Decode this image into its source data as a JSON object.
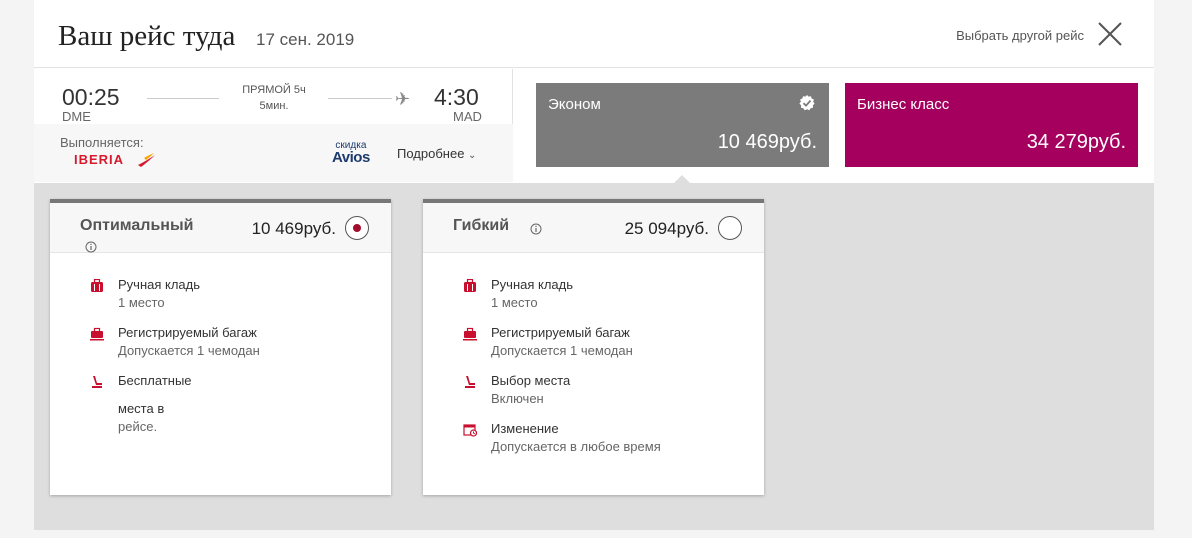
{
  "header": {
    "title": "Ваш рейс туда",
    "date": "17 сен. 2019",
    "change_flight": "Выбрать другой рейс"
  },
  "route": {
    "dep_time": "00:25",
    "dep_code": "DME",
    "arr_time": "4:30",
    "arr_code": "MAD",
    "type": "ПРЯМОЙ 5ч",
    "duration_extra": "5мин.",
    "operated_by": "Выполняется:",
    "airline": "IBERIA",
    "avios_top": "скидка",
    "avios_bottom": "Avios",
    "details": "Подробнее"
  },
  "classes": [
    {
      "name": "Эконом",
      "price": "10 469руб.",
      "color": "#7b7b7b",
      "selected": true
    },
    {
      "name": "Бизнес класс",
      "price": "34 279руб.",
      "color": "#a6005f",
      "selected": false
    }
  ],
  "fares": [
    {
      "name": "Оптимальный",
      "price": "10 469руб.",
      "selected": true,
      "features": [
        {
          "icon": "hand-luggage-icon",
          "title": "Ручная кладь",
          "sub": "1 место"
        },
        {
          "icon": "checked-baggage-icon",
          "title": "Регистрируемый багаж",
          "sub": "Допускается 1 чемодан"
        },
        {
          "icon": "seat-icon",
          "title": "Бесплатные",
          "sub": "",
          "extra1": "места в",
          "extra2": "рейсе."
        }
      ]
    },
    {
      "name": "Гибкий",
      "price": "25 094руб.",
      "selected": false,
      "features": [
        {
          "icon": "hand-luggage-icon",
          "title": "Ручная кладь",
          "sub": "1 место"
        },
        {
          "icon": "checked-baggage-icon",
          "title": "Регистрируемый багаж",
          "sub": "Допускается 1 чемодан"
        },
        {
          "icon": "seat-icon",
          "title": "Выбор места",
          "sub": "Включен"
        },
        {
          "icon": "change-calendar-icon",
          "title": "Изменение",
          "sub": "Допускается в любое время"
        }
      ]
    }
  ],
  "colors": {
    "accent_red": "#c8102e",
    "business": "#a6005f",
    "economy": "#7b7b7b"
  }
}
